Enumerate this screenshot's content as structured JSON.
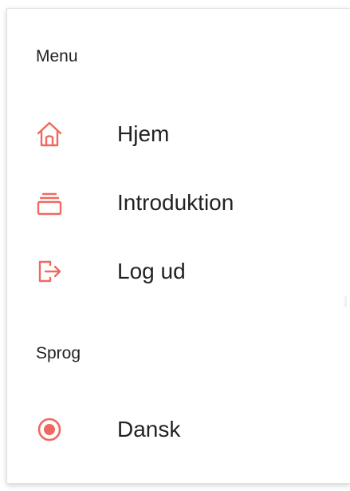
{
  "menu": {
    "section_title": "Menu",
    "items": [
      {
        "label": "Hjem",
        "icon": "home-icon"
      },
      {
        "label": "Introduktion",
        "icon": "layers-icon"
      },
      {
        "label": "Log ud",
        "icon": "logout-icon"
      }
    ]
  },
  "language": {
    "section_title": "Sprog",
    "options": [
      {
        "label": "Dansk",
        "selected": true
      }
    ]
  },
  "colors": {
    "accent": "#ee6a60",
    "text": "#222222",
    "background": "#ffffff"
  }
}
